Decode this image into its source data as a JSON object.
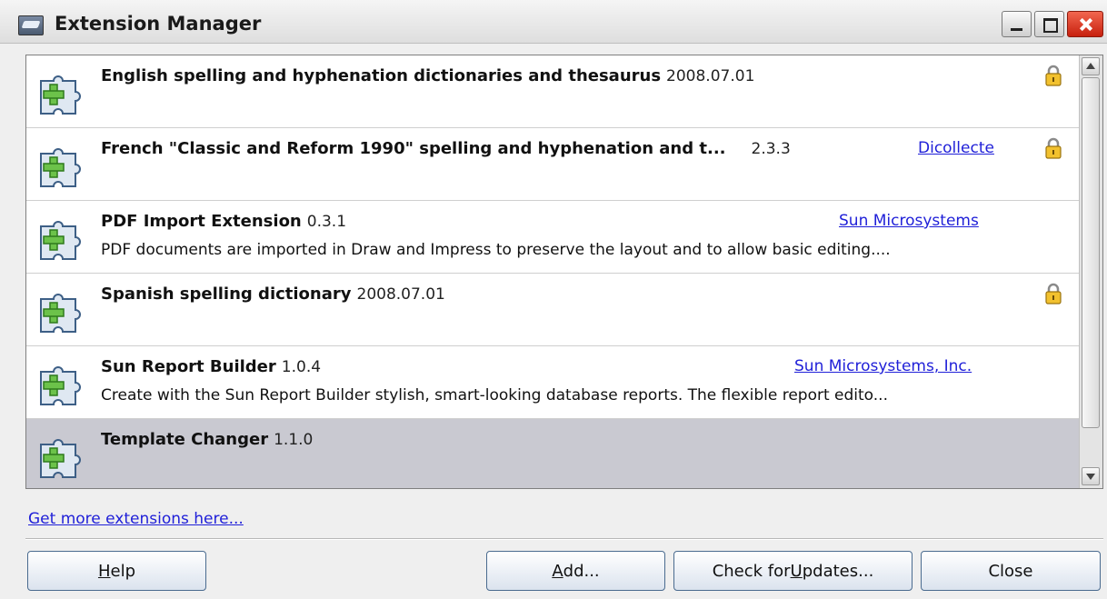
{
  "window": {
    "title": "Extension Manager"
  },
  "extensions": [
    {
      "name": "English spelling and hyphenation dictionaries and thesaurus",
      "version": "2008.07.01",
      "publisher": "",
      "description": "",
      "locked": true,
      "selected": false
    },
    {
      "name": "French \"Classic and Reform 1990\" spelling and hyphenation and t...",
      "version": "2.3.3",
      "publisher": "Dicollecte",
      "description": "",
      "locked": true,
      "selected": false
    },
    {
      "name": "PDF Import Extension",
      "version": "0.3.1",
      "publisher": "Sun Microsystems",
      "description": "PDF documents are imported in Draw and Impress to preserve the layout and to allow basic editing....",
      "locked": false,
      "selected": false
    },
    {
      "name": "Spanish spelling dictionary",
      "version": "2008.07.01",
      "publisher": "",
      "description": "",
      "locked": true,
      "selected": false
    },
    {
      "name": "Sun Report Builder",
      "version": "1.0.4",
      "publisher": "Sun Microsystems, Inc.",
      "description": "Create with the Sun Report Builder stylish, smart-looking database reports. The flexible report edito...",
      "locked": false,
      "selected": false
    },
    {
      "name": "Template Changer",
      "version": "1.1.0",
      "publisher": "",
      "description": "",
      "locked": false,
      "selected": true
    }
  ],
  "footer": {
    "more_link": "Get more extensions here...",
    "help_pre": "",
    "help_u": "H",
    "help_post": "elp",
    "add_pre": "",
    "add_u": "A",
    "add_post": "dd...",
    "updates_pre": "Check for ",
    "updates_u": "U",
    "updates_post": "pdates...",
    "close_label": "Close"
  },
  "icons": {
    "extension": "puzzle-plus-icon",
    "lock": "lock-icon"
  },
  "colors": {
    "link": "#1f1fd8",
    "selected_row": "#c9c9d1",
    "close_button": "#d9321c"
  }
}
